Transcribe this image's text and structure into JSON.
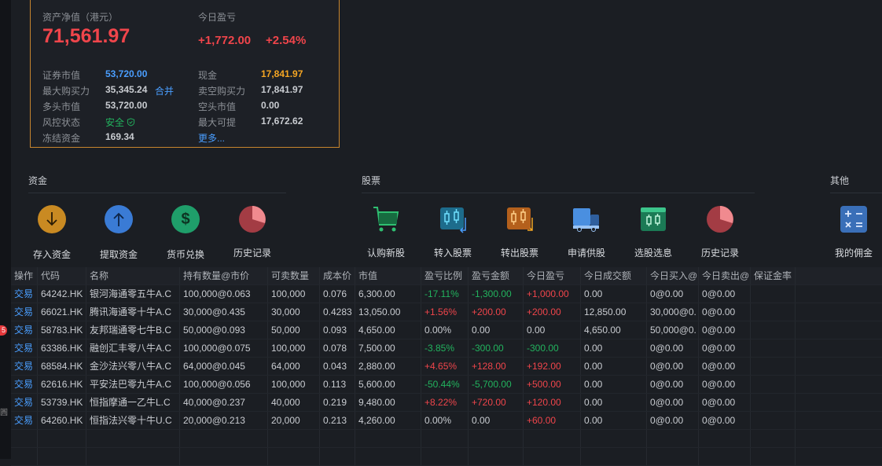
{
  "asset": {
    "net_label": "资产净值（港元）",
    "net_value": "71,561.97",
    "today_pl_label": "今日盈亏",
    "today_pl_value": "+1,772.00",
    "today_pl_pct": "+2.54%",
    "left_rows": [
      {
        "label": "证券市值",
        "value": "53,720.00"
      },
      {
        "label": "最大购买力",
        "value": "35,345.24"
      },
      {
        "label": "多头市值",
        "value": "53,720.00"
      },
      {
        "label": "风控状态",
        "value": "安全"
      },
      {
        "label": "冻结资金",
        "value": "169.34"
      }
    ],
    "merge_link": "合并",
    "right_rows": [
      {
        "label": "现金",
        "value": "17,841.97"
      },
      {
        "label": "卖空购买力",
        "value": "17,841.97"
      },
      {
        "label": "空头市值",
        "value": "0.00"
      },
      {
        "label": "最大可提",
        "value": "17,672.62"
      }
    ],
    "more_link": "更多..."
  },
  "sections": {
    "funds": {
      "title": "资金",
      "items": [
        "存入资金",
        "提取资金",
        "货币兑换",
        "历史记录"
      ]
    },
    "stocks": {
      "title": "股票",
      "items": [
        "认购新股",
        "转入股票",
        "转出股票",
        "申请供股",
        "选股选息",
        "历史记录"
      ]
    },
    "other": {
      "title": "其他",
      "items": [
        "我的佣金"
      ]
    }
  },
  "table": {
    "headers": [
      "操作",
      "代码",
      "名称",
      "持有数量@市价",
      "可卖数量",
      "成本价",
      "市值",
      "盈亏比例",
      "盈亏金额",
      "今日盈亏",
      "今日成交额",
      "今日买入@",
      "今日卖出@",
      "保证金率"
    ],
    "rows": [
      [
        "交易",
        "64242.HK",
        "银河海通零五牛A.C",
        "100,000@0.063",
        "100,000",
        "0.076",
        "6,300.00",
        "-17.11%",
        "-1,300.00",
        "+1,000.00",
        "0.00",
        "0@0.00",
        "0@0.00",
        ""
      ],
      [
        "交易",
        "66021.HK",
        "腾讯海通零十牛A.C",
        "30,000@0.435",
        "30,000",
        "0.4283",
        "13,050.00",
        "+1.56%",
        "+200.00",
        "+200.00",
        "12,850.00",
        "30,000@0.",
        "0@0.00",
        ""
      ],
      [
        "交易",
        "58783.HK",
        "友邦瑞通零七牛B.C",
        "50,000@0.093",
        "50,000",
        "0.093",
        "4,650.00",
        "0.00%",
        "0.00",
        "0.00",
        "4,650.00",
        "50,000@0.",
        "0@0.00",
        ""
      ],
      [
        "交易",
        "63386.HK",
        "融创汇丰零八牛A.C",
        "100,000@0.075",
        "100,000",
        "0.078",
        "7,500.00",
        "-3.85%",
        "-300.00",
        "-300.00",
        "0.00",
        "0@0.00",
        "0@0.00",
        ""
      ],
      [
        "交易",
        "68584.HK",
        "金沙法兴零八牛A.C",
        "64,000@0.045",
        "64,000",
        "0.043",
        "2,880.00",
        "+4.65%",
        "+128.00",
        "+192.00",
        "0.00",
        "0@0.00",
        "0@0.00",
        ""
      ],
      [
        "交易",
        "62616.HK",
        "平安法巴零九牛A.C",
        "100,000@0.056",
        "100,000",
        "0.113",
        "5,600.00",
        "-50.44%",
        "-5,700.00",
        "+500.00",
        "0.00",
        "0@0.00",
        "0@0.00",
        ""
      ],
      [
        "交易",
        "53739.HK",
        "恒指摩通一乙牛L.C",
        "40,000@0.237",
        "40,000",
        "0.219",
        "9,480.00",
        "+8.22%",
        "+720.00",
        "+120.00",
        "0.00",
        "0@0.00",
        "0@0.00",
        ""
      ],
      [
        "交易",
        "64260.HK",
        "恒指法兴零十牛U.C",
        "20,000@0.213",
        "20,000",
        "0.213",
        "4,260.00",
        "0.00%",
        "0.00",
        "+60.00",
        "0.00",
        "0@0.00",
        "0@0.00",
        ""
      ]
    ]
  },
  "sidebar": {
    "badge": "5",
    "glyph": "圓"
  },
  "colors": {
    "up": "#f0454b",
    "down": "#22b35e",
    "accent": "#4a9eff",
    "border": "#c8852e"
  }
}
